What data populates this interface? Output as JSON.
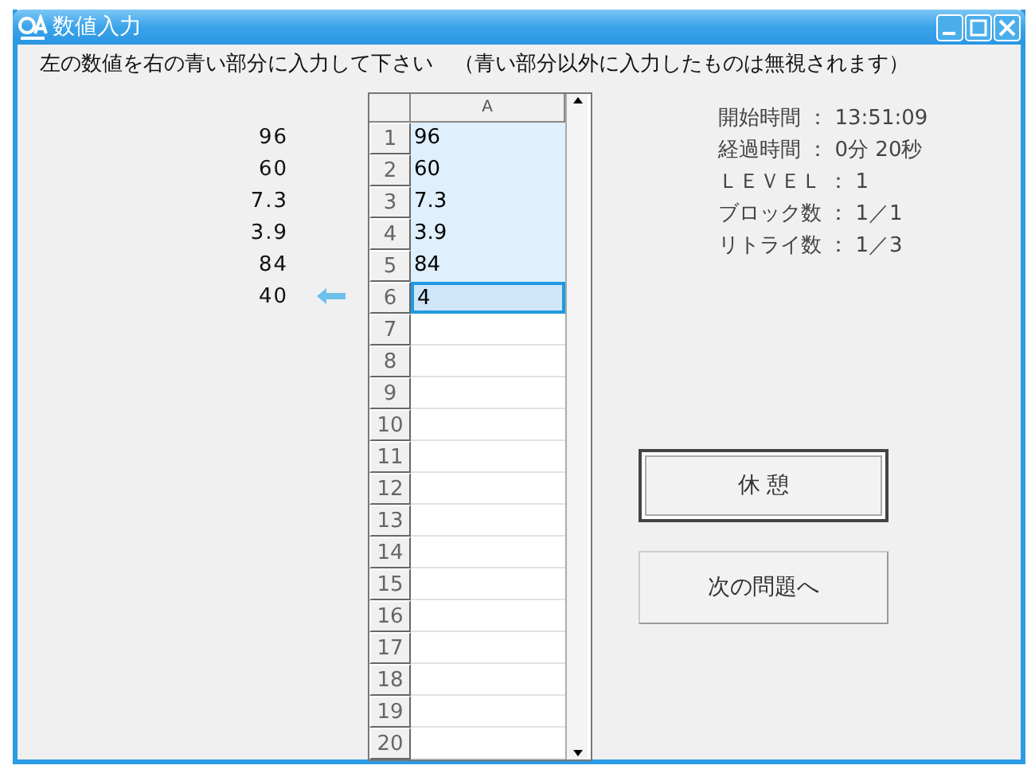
{
  "window": {
    "title": "数値入力"
  },
  "instruction": "左の数値を右の青い部分に入力して下さい　（青い部分以外に入力したものは無視されます）",
  "prompts": [
    {
      "value": "96",
      "current": false
    },
    {
      "value": "60",
      "current": false
    },
    {
      "value": "7.3",
      "current": false
    },
    {
      "value": "3.9",
      "current": false
    },
    {
      "value": "84",
      "current": false
    },
    {
      "value": "40",
      "current": true
    }
  ],
  "sheet": {
    "column": "A",
    "rows": [
      {
        "number": "1",
        "value": "96",
        "input_area": true,
        "selected": false
      },
      {
        "number": "2",
        "value": "60",
        "input_area": true,
        "selected": false
      },
      {
        "number": "3",
        "value": "7.3",
        "input_area": true,
        "selected": false
      },
      {
        "number": "4",
        "value": "3.9",
        "input_area": true,
        "selected": false
      },
      {
        "number": "5",
        "value": "84",
        "input_area": true,
        "selected": false
      },
      {
        "number": "6",
        "value": "4",
        "input_area": true,
        "selected": true
      },
      {
        "number": "7",
        "input_area": false,
        "selected": false
      },
      {
        "number": "8",
        "input_area": false,
        "selected": false
      },
      {
        "number": "9",
        "input_area": false,
        "selected": false
      },
      {
        "number": "10",
        "input_area": false,
        "selected": false
      },
      {
        "number": "11",
        "input_area": false,
        "selected": false
      },
      {
        "number": "12",
        "input_area": false,
        "selected": false
      },
      {
        "number": "13",
        "input_area": false,
        "selected": false
      },
      {
        "number": "14",
        "input_area": false,
        "selected": false
      },
      {
        "number": "15",
        "input_area": false,
        "selected": false
      },
      {
        "number": "16",
        "input_area": false,
        "selected": false
      },
      {
        "number": "17",
        "input_area": false,
        "selected": false
      },
      {
        "number": "18",
        "input_area": false,
        "selected": false
      },
      {
        "number": "19",
        "input_area": false,
        "selected": false
      },
      {
        "number": "20",
        "input_area": false,
        "selected": false
      }
    ]
  },
  "info": [
    "開始時間 ： 13:51:09",
    "経過時間 ： 0分 20秒",
    "ＬＥＶＥＬ ： 1",
    "ブロック数 ： 1／1",
    "リトライ数 ： 1／3"
  ],
  "buttons": [
    {
      "label": "休 憩",
      "default": true
    },
    {
      "label": "次の問題へ",
      "default": false
    }
  ]
}
